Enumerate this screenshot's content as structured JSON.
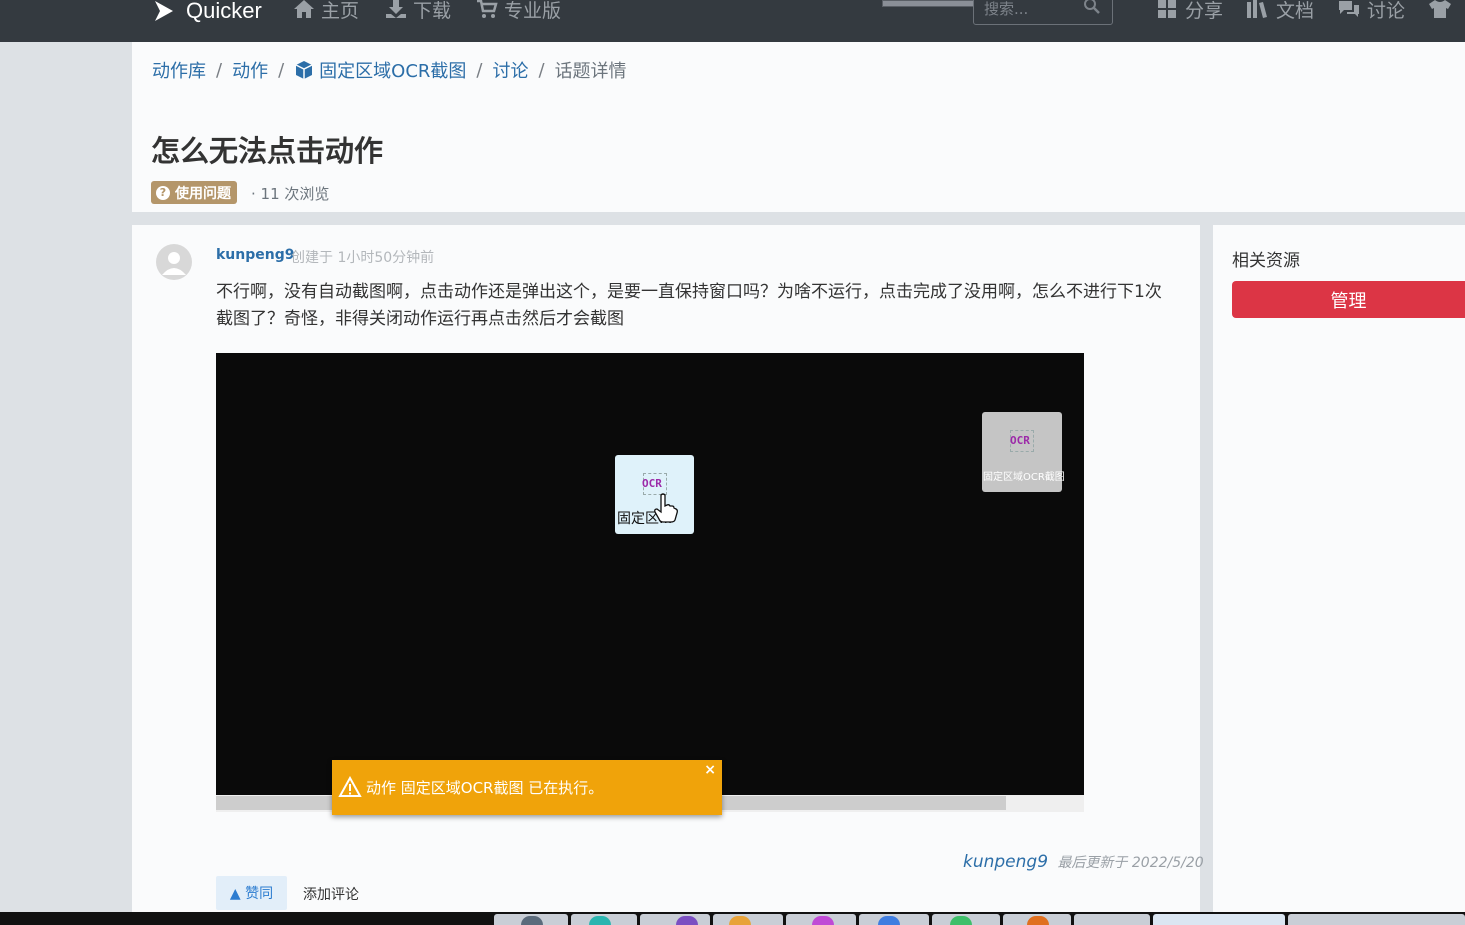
{
  "navbar": {
    "brand": "Quicker",
    "items": [
      "主页",
      "下载",
      "专业版"
    ],
    "right_items": [
      "分享",
      "文档",
      "讨论"
    ],
    "search_placeholder": "搜索..."
  },
  "breadcrumb": {
    "items": [
      "动作库",
      "动作",
      "固定区域OCR截图",
      "讨论"
    ],
    "current": "话题详情",
    "separator": "/"
  },
  "topic": {
    "title": "怎么无法点击动作",
    "tag": "使用问题",
    "views": "· 11 次浏览"
  },
  "post": {
    "author": "kunpeng9",
    "created": "创建于 1小时50分钟前",
    "content": "不行啊，没有自动截图啊，点击动作还是弹出这个，是要一直保持窗口吗？为啥不运行，点击完成了没用啊，怎么不进行下1次截图了？奇怪，非得关闭动作运行再点击然后才会截图",
    "embedded": {
      "tile1_icon_text": "OCR",
      "tile1_label": "固定区...",
      "tile2_icon_text": "OCR",
      "tile2_label": "固定区域OCR截图",
      "toast_message": "动作 固定区域OCR截图 已在执行。",
      "toast_close": "×"
    },
    "updated_by": "kunpeng9",
    "updated_text": "最后更新于 2022/5/20",
    "vote_label": "▲ 赞同",
    "comment_label": "添加评论"
  },
  "sidebar": {
    "title": "相关资源",
    "manage_label": "管理"
  },
  "colors": {
    "navbar": "#343a40",
    "link": "#2c6ea8",
    "tag": "#b4966a",
    "danger": "#dc3545",
    "toast": "#f0a30a"
  },
  "icons": [
    "quicker-logo-icon",
    "home-icon",
    "download-icon",
    "cart-icon",
    "grid-icon",
    "books-icon",
    "comments-icon",
    "shirt-icon",
    "search-icon",
    "cube-icon",
    "question-icon",
    "user-avatar-icon",
    "warning-icon",
    "hand-cursor-icon"
  ]
}
